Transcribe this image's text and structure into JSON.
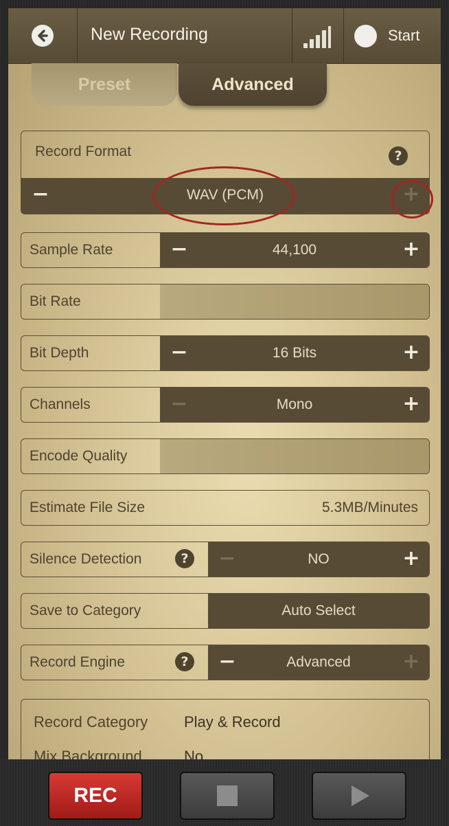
{
  "header": {
    "title": "New Recording",
    "start_label": "Start"
  },
  "tabs": [
    {
      "label": "Preset",
      "active": false
    },
    {
      "label": "Advanced",
      "active": true
    }
  ],
  "record_format": {
    "label": "Record Format",
    "help": "?",
    "value": "WAV (PCM)",
    "minus": "−",
    "plus": "+"
  },
  "rows": {
    "sample_rate": {
      "label": "Sample Rate",
      "value": "44,100",
      "minus": "−",
      "plus": "+"
    },
    "bit_rate": {
      "label": "Bit Rate"
    },
    "bit_depth": {
      "label": "Bit Depth",
      "value": "16 Bits",
      "minus": "−",
      "plus": "+"
    },
    "channels": {
      "label": "Channels",
      "value": "Mono",
      "minus": "−",
      "plus": "+"
    },
    "encode_quality": {
      "label": "Encode Quality"
    },
    "estimate_file_size": {
      "label": "Estimate File Size",
      "value": "5.3MB/Minutes"
    },
    "silence_detection": {
      "label": "Silence Detection",
      "help": "?",
      "value": "NO",
      "minus": "−",
      "plus": "+"
    },
    "save_to_category": {
      "label": "Save to Category",
      "value": "Auto Select"
    },
    "record_engine": {
      "label": "Record Engine",
      "help": "?",
      "value": "Advanced",
      "minus": "−",
      "plus": "+"
    }
  },
  "info": {
    "record_category_label": "Record Category",
    "record_category_value": "Play & Record",
    "mix_background_label": "Mix Background",
    "mix_background_value": "No"
  },
  "toolbar": {
    "rec_label": "REC"
  },
  "colors": {
    "annotation": "#a3261f",
    "control_dark": "#574b36",
    "rec_red": "#c82c25"
  }
}
